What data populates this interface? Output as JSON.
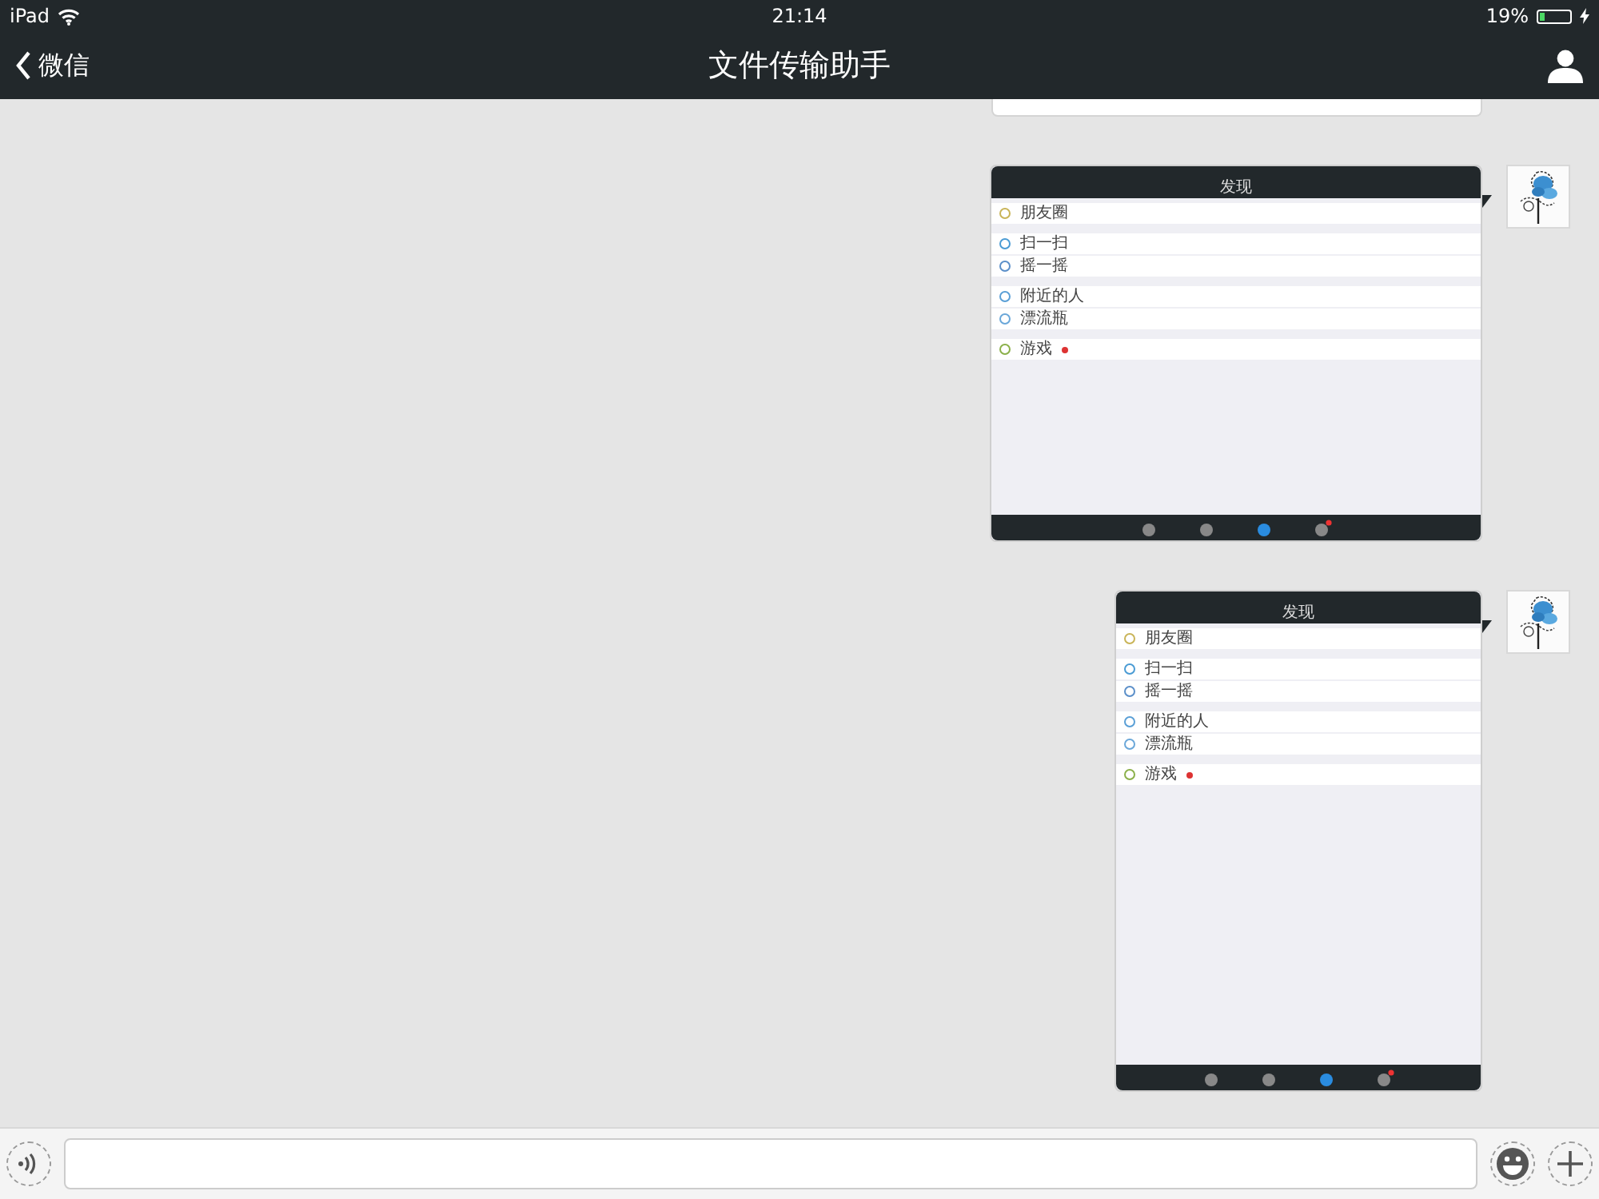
{
  "status_bar": {
    "carrier": "iPad",
    "time": "21:14",
    "battery": "19%"
  },
  "nav": {
    "back": "微信",
    "title": "文件传输助手"
  },
  "messages": [
    {
      "kind": "cropped"
    },
    {
      "kind": "landscape_image",
      "screenshot": {
        "title": "发现",
        "groups": [
          [
            {
              "label": "朋友圈",
              "color": "#c9b458",
              "badge": false
            }
          ],
          [
            {
              "label": "扫一扫",
              "color": "#4a9bd4",
              "badge": false
            },
            {
              "label": "摇一摇",
              "color": "#5b8fc9",
              "badge": false
            }
          ],
          [
            {
              "label": "附近的人",
              "color": "#5a9fd6",
              "badge": false
            },
            {
              "label": "漂流瓶",
              "color": "#6aa7d9",
              "badge": false
            }
          ],
          [
            {
              "label": "游戏",
              "color": "#8bb04a",
              "badge": true
            }
          ]
        ],
        "tabs": [
          {
            "selected": false,
            "badge": false
          },
          {
            "selected": false,
            "badge": false
          },
          {
            "selected": true,
            "badge": false
          },
          {
            "selected": false,
            "badge": true
          }
        ]
      }
    },
    {
      "kind": "portrait_image",
      "screenshot": {
        "title": "发现",
        "groups": [
          [
            {
              "label": "朋友圈",
              "color": "#c9b458",
              "badge": false
            }
          ],
          [
            {
              "label": "扫一扫",
              "color": "#4a9bd4",
              "badge": false
            },
            {
              "label": "摇一摇",
              "color": "#5b8fc9",
              "badge": false
            }
          ],
          [
            {
              "label": "附近的人",
              "color": "#5a9fd6",
              "badge": false
            },
            {
              "label": "漂流瓶",
              "color": "#6aa7d9",
              "badge": false
            }
          ],
          [
            {
              "label": "游戏",
              "color": "#8bb04a",
              "badge": true
            }
          ]
        ],
        "tabs": [
          {
            "selected": false,
            "badge": false
          },
          {
            "selected": false,
            "badge": false
          },
          {
            "selected": true,
            "badge": false
          },
          {
            "selected": false,
            "badge": true
          }
        ]
      }
    }
  ],
  "input_bar": {
    "voice": true,
    "emoji": true,
    "plus": true
  }
}
